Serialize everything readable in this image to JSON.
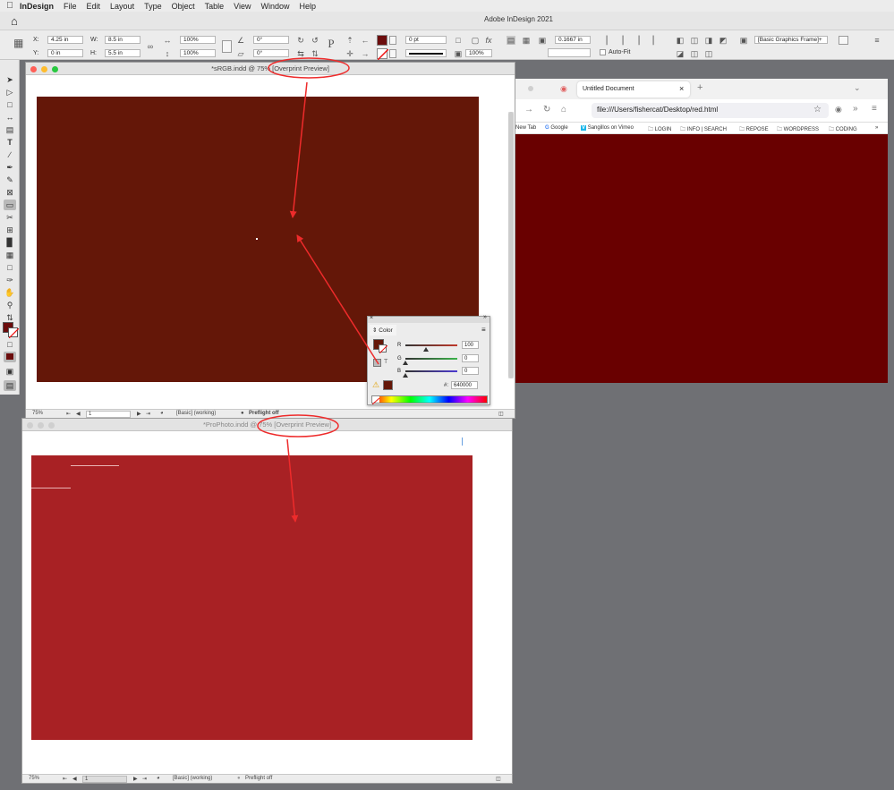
{
  "menubar": {
    "app_name": "InDesign",
    "items": [
      "File",
      "Edit",
      "Layout",
      "Type",
      "Object",
      "Table",
      "View",
      "Window",
      "Help"
    ]
  },
  "app_title": "Adobe InDesign 2021",
  "control_panel": {
    "x_label": "X:",
    "x_value": "4.25 in",
    "y_label": "Y:",
    "y_value": "0 in",
    "w_label": "W:",
    "w_value": "8.5 in",
    "h_label": "H:",
    "h_value": "5.5 in",
    "scale_x": "100%",
    "scale_y": "100%",
    "angle": "0°",
    "shear": "0°",
    "stroke_weight": "0 pt",
    "opacity": "100%",
    "offset": "0.1667 in",
    "auto_fit_label": "Auto-Fit",
    "object_style": "[Basic Graphics Frame]+"
  },
  "doc1": {
    "title": "*sRGB.indd @ 75% [Overprint Preview]",
    "fill_color": "#641708",
    "status": {
      "zoom": "75%",
      "page": "1",
      "profile": "[Basic] (working)",
      "preflight": "Preflight off"
    }
  },
  "doc2": {
    "title": "*ProPhoto.indd @ 75% [Overprint Preview]",
    "fill_color": "#a82124",
    "status": {
      "zoom": "75%",
      "page": "1",
      "profile": "[Basic] (working)",
      "preflight": "Preflight off"
    }
  },
  "color_panel": {
    "title": "Color",
    "channels": [
      {
        "label": "R",
        "value": "100",
        "level": 0.39,
        "track_color": "#c0392b"
      },
      {
        "label": "G",
        "value": "0",
        "level": 0,
        "track_color": "#3bb34a"
      },
      {
        "label": "B",
        "value": "0",
        "level": 0,
        "track_color": "#4d3bd0"
      }
    ],
    "hex_label": "#:",
    "hex_value": "640000",
    "swatch_color": "#641708"
  },
  "browser": {
    "tab_title": "Untitled Document",
    "url": "file:///Users/fishercat/Desktop/red.html",
    "bookmarks": [
      "New Tab",
      "Google",
      "Sangillos on Vimeo",
      "LOGIN",
      "INFO | SEARCH",
      "REPOSE",
      "WORDPRESS",
      "CODING"
    ],
    "page_color": "#690000"
  },
  "annotations": {
    "color": "#ee2b2b"
  }
}
